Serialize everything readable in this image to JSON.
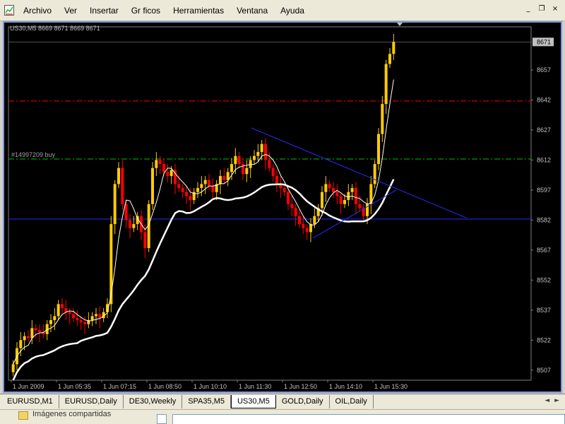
{
  "menu": {
    "items": [
      "Archivo",
      "Ver",
      "Insertar",
      "Gr ficos",
      "Herramientas",
      "Ventana",
      "Ayuda"
    ]
  },
  "window_controls": {
    "minimize": "_",
    "restore": "❐",
    "close": "×"
  },
  "chart": {
    "title": "US30,M5  8669 8671 8669 8671",
    "order_label": "#14997209 buy",
    "current_price": "8671",
    "price_ticks": [
      "8657",
      "8642",
      "8627",
      "8612",
      "8597",
      "8582",
      "8567",
      "8552",
      "8537",
      "8522",
      "8507"
    ],
    "time_ticks": [
      "1 Jun 2009",
      "1 Jun 05:35",
      "1 Jun 07:15",
      "1 Jun 08:50",
      "1 Jun 10:10",
      "1 Jun 11:30",
      "1 Jun 12:50",
      "1 Jun 14:10",
      "1 Jun 15:30"
    ],
    "colors": {
      "background": "#000000",
      "up_candle": "#ffcc00",
      "down_candle": "#ff0000",
      "ma_fast": "#ffffff",
      "ma_slow": "#ffffff",
      "trendline": "#2a2aff",
      "red_level": "#ff0000",
      "green_level": "#00c000",
      "axis_text": "#c0c0c0"
    }
  },
  "chart_data": {
    "type": "candlestick",
    "symbol": "US30",
    "timeframe": "M5",
    "ylim": [
      8502,
      8675
    ],
    "levels": [
      {
        "price": 8641.5,
        "style": "dash-dot",
        "color": "#ff0000"
      },
      {
        "price": 8612.5,
        "style": "dash-dot",
        "color": "#00c000",
        "label": "#14997209 buy"
      },
      {
        "price": 8582.5,
        "style": "solid",
        "color": "#2a2aff"
      }
    ],
    "closes": [
      8510,
      8518,
      8522,
      8524,
      8523,
      8528,
      8527,
      8526,
      8525,
      8530,
      8532,
      8534,
      8540,
      8538,
      8536,
      8535,
      8533,
      8532,
      8531,
      8530,
      8532,
      8534,
      8535,
      8533,
      8536,
      8540,
      8580,
      8600,
      8608,
      8590,
      8582,
      8578,
      8580,
      8584,
      8576,
      8568,
      8590,
      8608,
      8612,
      8610,
      8606,
      8604,
      8607,
      8600,
      8598,
      8596,
      8594,
      8592,
      8596,
      8598,
      8600,
      8602,
      8599,
      8596,
      8600,
      8604,
      8602,
      8606,
      8610,
      8614,
      8610,
      8605,
      8608,
      8612,
      8614,
      8616,
      8620,
      8612,
      8608,
      8604,
      8600,
      8598,
      8596,
      8590,
      8588,
      8584,
      8580,
      8578,
      8576,
      8580,
      8584,
      8588,
      8596,
      8600,
      8598,
      8596,
      8594,
      8590,
      8592,
      8596,
      8598,
      8590,
      8588,
      8584,
      8590,
      8600,
      8610,
      8625,
      8640,
      8660,
      8665,
      8671
    ]
  },
  "tabs": [
    {
      "label": "EURUSD,M1",
      "active": false
    },
    {
      "label": "EURUSD,Daily",
      "active": false
    },
    {
      "label": "DE30,Weekly",
      "active": false
    },
    {
      "label": "SPA35,M5",
      "active": false
    },
    {
      "label": "US30,M5",
      "active": true
    },
    {
      "label": "GOLD,Daily",
      "active": false
    },
    {
      "label": "OIL,Daily",
      "active": false
    }
  ],
  "tab_nav": "◄ ►",
  "bottom": {
    "shared_label": "Imágenes compartidas"
  }
}
